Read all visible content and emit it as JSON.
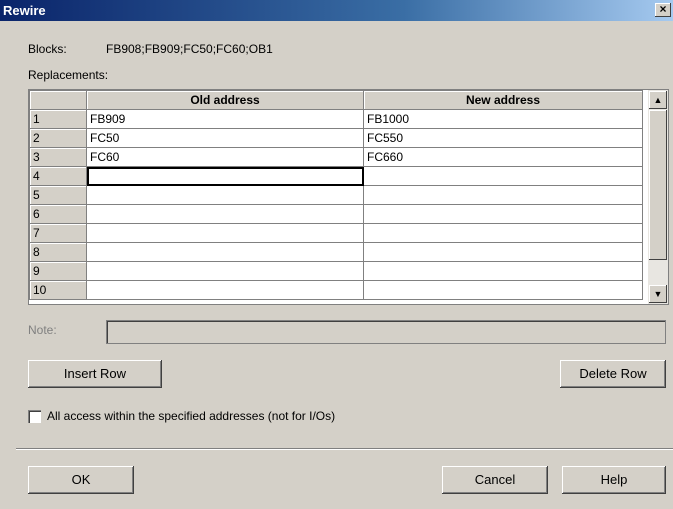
{
  "window": {
    "title": "Rewire",
    "close_label": "×"
  },
  "blocks": {
    "label": "Blocks:",
    "value": "FB908;FB909;FC50;FC60;OB1"
  },
  "replacements_label": "Replacements:",
  "grid": {
    "headers": {
      "old": "Old address",
      "new": "New address"
    },
    "rows": [
      {
        "num": "1",
        "old": "FB909",
        "new": "FB1000"
      },
      {
        "num": "2",
        "old": "FC50",
        "new": "FC550"
      },
      {
        "num": "3",
        "old": "FC60",
        "new": "FC660"
      },
      {
        "num": "4",
        "old": "",
        "new": ""
      },
      {
        "num": "5",
        "old": "",
        "new": ""
      },
      {
        "num": "6",
        "old": "",
        "new": ""
      },
      {
        "num": "7",
        "old": "",
        "new": ""
      },
      {
        "num": "8",
        "old": "",
        "new": ""
      },
      {
        "num": "9",
        "old": "",
        "new": ""
      },
      {
        "num": "10",
        "old": "",
        "new": ""
      }
    ],
    "scroll_up": "▲",
    "scroll_down": "▼"
  },
  "note": {
    "label": "Note:",
    "value": ""
  },
  "buttons": {
    "insert_row": "Insert Row",
    "delete_row": "Delete Row",
    "ok": "OK",
    "cancel": "Cancel",
    "help": "Help"
  },
  "checkbox": {
    "label": "All access within the specified addresses (not for I/Os)",
    "checked": false
  }
}
